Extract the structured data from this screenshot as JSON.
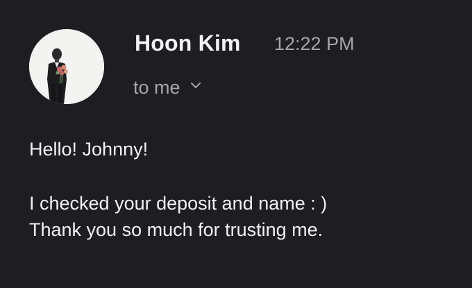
{
  "message": {
    "sender_name": "Hoon Kim",
    "time": "12:22 PM",
    "recipient_label": "to me",
    "greeting": "Hello! Johnny!",
    "body_lines": [
      "I checked your deposit and name : )",
      "Thank you so much for trusting me."
    ]
  },
  "icons": {
    "expand": "chevron-down-icon",
    "avatar": "sender-avatar"
  },
  "colors": {
    "background": "#1e1d21",
    "primary_text": "#f2f2f4",
    "secondary_text": "#a6a6ab",
    "avatar_background": "#f3f3f1"
  }
}
